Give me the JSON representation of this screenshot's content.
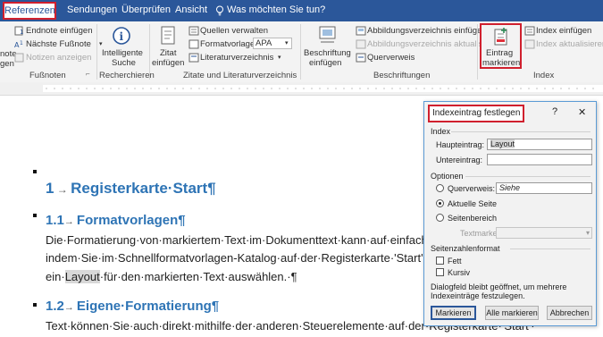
{
  "tabs": {
    "referenzen": "Referenzen",
    "sendungen": "Sendungen",
    "ueberpruefen": "Überprüfen",
    "ansicht": "Ansicht",
    "tell_me": "Was möchten Sie tun?"
  },
  "ribbon": {
    "footnotes": {
      "endnote": "Endnote einfügen",
      "next_footnote": "Nächste Fußnote",
      "show_notes": "Notizen anzeigen",
      "left_partial_1": "note",
      "left_partial_2": "gen",
      "group_label": "Fußnoten"
    },
    "research": {
      "smart_lookup_1": "Intelligente",
      "smart_lookup_2": "Suche",
      "group_label": "Recherchieren"
    },
    "citations": {
      "insert_citation_1": "Zitat",
      "insert_citation_2": "einfügen",
      "manage_sources": "Quellen verwalten",
      "style_label": "Formatvorlage:",
      "style_value": "APA",
      "bibliography": "Literaturverzeichnis",
      "group_label": "Zitate und Literaturverzeichnis"
    },
    "captions": {
      "insert_caption_1": "Beschriftung",
      "insert_caption_2": "einfügen",
      "insert_tof": "Abbildungsverzeichnis einfügen",
      "update_tof": "Abbildungsverzeichnis aktualisieren",
      "cross_ref": "Querverweis",
      "group_label": "Beschriftungen"
    },
    "index": {
      "mark_entry_1": "Eintrag",
      "mark_entry_2": "markieren",
      "insert_index": "Index einfügen",
      "update_index": "Index aktualisieren",
      "group_label": "Index"
    }
  },
  "document": {
    "h1_number": "1",
    "h1_title": "Registerkarte·Start¶",
    "h2a_number": "1.1",
    "h2a_title": "Formatvorlagen¶",
    "p1_line1": "Die·Formatierung·von·markiertem·Text·im·Dokumenttext·kann·auf·einfach",
    "p1_line2": "indem·Sie·im·Schnellformatvorlagen-Katalog·auf·der·Registerkarte·'Start'·e",
    "p1_line3_a": "ein·",
    "p1_line3_highlight": "Layout",
    "p1_line3_b": "·für·den·markierten·Text·auswählen.·¶",
    "h2b_number": "1.2",
    "h2b_title": "Eigene·Formatierung¶",
    "p2_line1": "Text·können·Sie·auch·direkt·mithilfe·der·anderen·Steuerelemente·auf·der·Registerkarte·'Start'·"
  },
  "dialog": {
    "title": "Indexeintrag festlegen",
    "help": "?",
    "close": "✕",
    "section_index": "Index",
    "main_entry_label": "Haupteintrag:",
    "main_entry_value": "Layout",
    "sub_entry_label": "Untereintrag:",
    "sub_entry_value": "",
    "section_options": "Optionen",
    "cross_ref_label": "Querverweis:",
    "cross_ref_value": "Siehe",
    "current_page_label": "Aktuelle Seite",
    "page_range_label": "Seitenbereich",
    "bookmark_label": "Textmarke:",
    "section_page_format": "Seitenzahlenformat",
    "bold_label": "Fett",
    "italic_label": "Kursiv",
    "info_line1": "Dialogfeld bleibt geöffnet, um mehrere",
    "info_line2": "Indexeinträge festzulegen.",
    "btn_mark": "Markieren",
    "btn_mark_all": "Alle markieren",
    "btn_cancel": "Abbrechen",
    "selected_option": "Aktuelle Seite"
  },
  "colors": {
    "ribbon_blue": "#2b579a",
    "heading_blue": "#2e74b5",
    "highlight_red": "#d0202e"
  }
}
